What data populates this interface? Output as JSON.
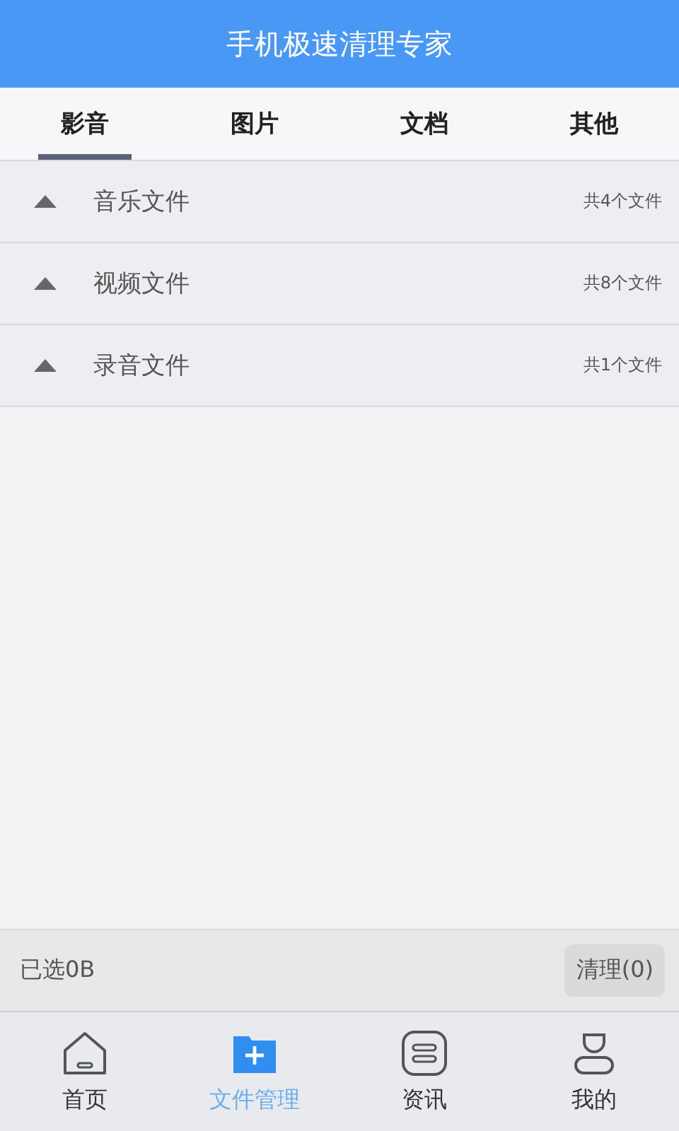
{
  "header": {
    "title": "手机极速清理专家"
  },
  "tabs": [
    {
      "label": "影音",
      "selected": true
    },
    {
      "label": "图片",
      "selected": false
    },
    {
      "label": "文档",
      "selected": false
    },
    {
      "label": "其他",
      "selected": false
    }
  ],
  "groups": [
    {
      "name": "音乐文件",
      "count": "共4个文件",
      "expanded": false
    },
    {
      "name": "视频文件",
      "count": "共8个文件",
      "expanded": false
    },
    {
      "name": "录音文件",
      "count": "共1个文件",
      "expanded": false
    }
  ],
  "footer": {
    "selected_size": "已选0B",
    "clean_button": "清理(0)"
  },
  "nav": [
    {
      "kind": "home",
      "label": "首页",
      "selected": false
    },
    {
      "kind": "files",
      "label": "文件管理",
      "selected": true
    },
    {
      "kind": "news",
      "label": "资讯",
      "selected": false
    },
    {
      "kind": "profile",
      "label": "我的",
      "selected": false
    }
  ]
}
